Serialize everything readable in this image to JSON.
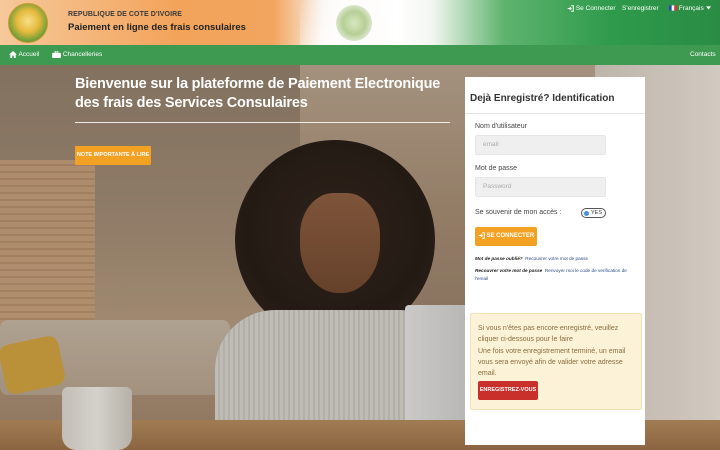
{
  "header": {
    "republic": "REPUBLIQUE DE COTE D'IVOIRE",
    "subtitle": "Paiement en ligne des frais consulaires",
    "links": {
      "login": "Se Connecter",
      "register": "S'enregistrer",
      "language": "Français"
    }
  },
  "nav": {
    "home": "Accueil",
    "chancelleries": "Chancelleries",
    "contacts": "Contacts"
  },
  "hero": {
    "title": "Bienvenue sur la plateforme de Paiement Electronique des frais des Services Consulaires",
    "note_button": "NOTE IMPORTANTE À LIRE"
  },
  "login": {
    "title": "Dejà Enregistré? Identification",
    "username_label": "Nom d'utilisateur",
    "username_placeholder": "email",
    "password_label": "Mot de passe",
    "password_placeholder": "Password",
    "remember_label": "Se souvenir de mon accès :",
    "remember_toggle": "YES",
    "submit": "SE CONNECTER",
    "forgot_q": "Mot de passe oublié?",
    "forgot_link": "Recouvrer votre mot de passe",
    "recover_q": "Recouvrer votre mot de passe",
    "recover_link_1": "Renvoyer moi le code de verification de",
    "recover_link_2": "l'email"
  },
  "register": {
    "line1": "Si vous n'êtes pas encore enregistré, veuillez",
    "line2": "cliquer ci-dessous pour le faire",
    "line3": "Une fois votre enregistrement terminé, un email",
    "line4": "vous sera envoyé afin de valider votre adresse",
    "line5": "email.",
    "button": "ENREGISTREZ-VOUS"
  },
  "colors": {
    "nav_green": "#3d9a50",
    "orange_button": "#f2a122",
    "register_red": "#c9302c"
  }
}
